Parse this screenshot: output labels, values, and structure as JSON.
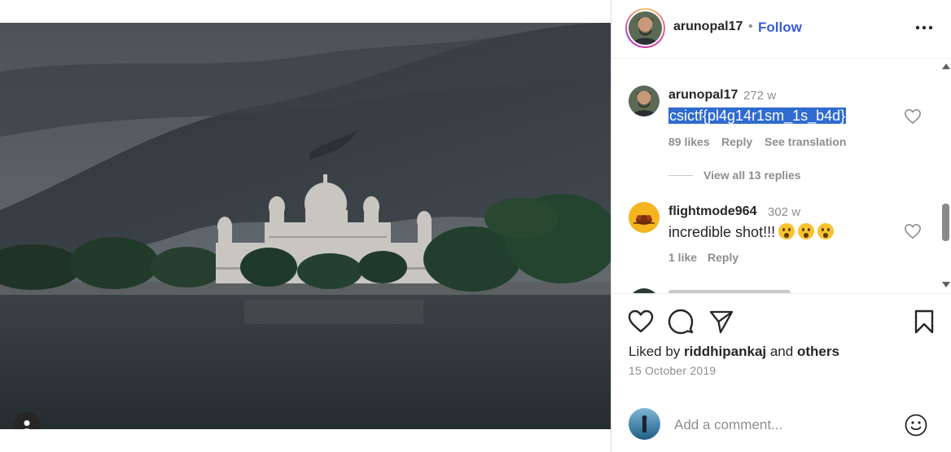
{
  "post": {
    "username": "arunopal17",
    "separator": "•",
    "follow_label": "Follow",
    "more_icon": "more-horizontal-icon"
  },
  "comments": [
    {
      "username": "arunopal17",
      "time": "272 w",
      "text": "csictf{pl4g14r1sm_1s_b4d}",
      "text_highlighted": true,
      "likes": "89 likes",
      "reply_label": "Reply",
      "translate_label": "See translation",
      "view_replies": "View all 13 replies"
    },
    {
      "username": "flightmode964",
      "time": "302 w",
      "text": "incredible shot!!!",
      "emoji_count": 3,
      "likes": "1 like",
      "reply_label": "Reply"
    }
  ],
  "actions": {
    "like_icon": "heart-icon",
    "comment_icon": "comment-icon",
    "share_icon": "send-icon",
    "save_icon": "bookmark-icon"
  },
  "likes": {
    "prefix": "Liked by ",
    "user": "riddhipankaj",
    "middle": " and ",
    "others": "others"
  },
  "date": "15 October 2019",
  "add_comment": {
    "placeholder": "Add a comment...",
    "emoji_icon": "smiley-icon"
  },
  "colors": {
    "accent": "#3a5bd9",
    "highlight": "#2f6bd0",
    "muted": "#8e8e8e",
    "text": "#262626"
  }
}
